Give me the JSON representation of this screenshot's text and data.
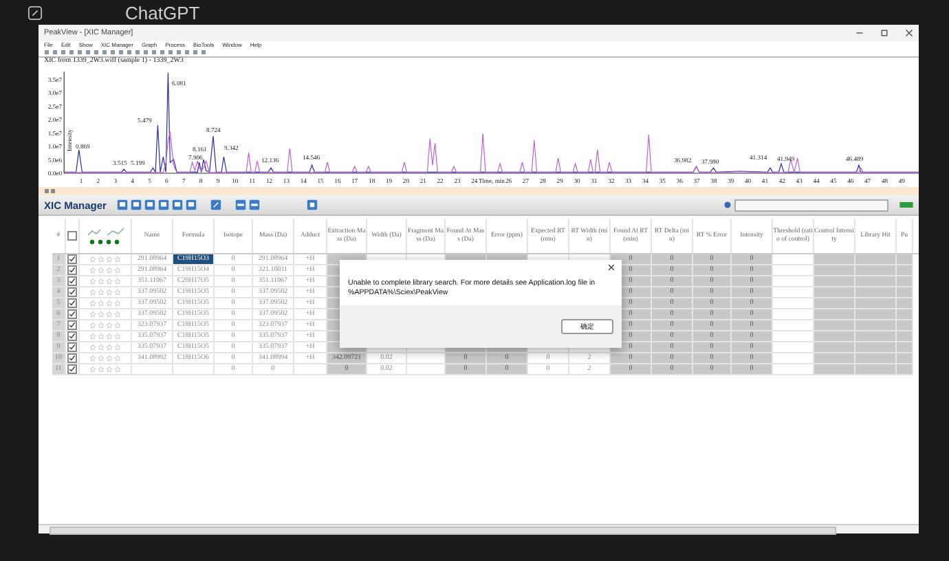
{
  "background_app": {
    "title": "ChatGPT"
  },
  "window": {
    "title": "PeakView - [XIC Manager]"
  },
  "menu": [
    "File",
    "Edit",
    "Show",
    "XIC Manager",
    "Graph",
    "Process",
    "BioTools",
    "Window",
    "Help"
  ],
  "chart": {
    "chart_data": {
      "type": "line",
      "title": "XIC from 1339_2W3.wiff (sample 1) - 1339_2W3",
      "xlabel": "Time, min",
      "ylabel": "Intensity",
      "xlim": [
        0,
        50
      ],
      "ylim": [
        0,
        38000000.0
      ],
      "xticks": [
        1,
        2,
        3,
        4,
        5,
        6,
        7,
        8,
        9,
        10,
        11,
        12,
        13,
        14,
        15,
        16,
        17,
        18,
        19,
        20,
        21,
        22,
        23,
        24,
        26,
        27,
        28,
        29,
        30,
        31,
        32,
        33,
        34,
        35,
        36,
        37,
        38,
        39,
        40,
        41,
        42,
        43,
        44,
        45,
        46,
        47,
        48,
        49
      ],
      "yticks": [
        {
          "value": 35000000.0,
          "label": "3.5e7"
        },
        {
          "value": 30000000.0,
          "label": "3.0e7"
        },
        {
          "value": 25000000.0,
          "label": "2.5e7"
        },
        {
          "value": 20000000.0,
          "label": "2.0e7"
        },
        {
          "value": 15000000.0,
          "label": "1.5e7"
        },
        {
          "value": 10000000.0,
          "label": "1.0e7"
        },
        {
          "value": 5000000.0,
          "label": "5.0e6"
        },
        {
          "value": 0,
          "label": "0.0e0"
        }
      ],
      "x": [
        0,
        0.7,
        0.87,
        1.05,
        3.35,
        3.5,
        3.65,
        5.05,
        5.2,
        5.34,
        5.48,
        5.62,
        5.8,
        5.95,
        6.08,
        6.2,
        6.4,
        6.6,
        7.35,
        7.5,
        7.65,
        7.8,
        7.9,
        8.03,
        8.16,
        8.3,
        8.5,
        8.72,
        8.9,
        9.2,
        9.34,
        9.5,
        10.65,
        10.8,
        10.95,
        11.15,
        11.3,
        11.45,
        11.95,
        12.1,
        12.25,
        13.05,
        13.2,
        13.35,
        14.35,
        14.5,
        14.65,
        15.25,
        15.4,
        15.55,
        16.85,
        17,
        17.15,
        17.65,
        17.8,
        17.95,
        19.75,
        19.9,
        20.05,
        21.25,
        21.4,
        21.55,
        21.7,
        21.85,
        22.65,
        22.8,
        22.95,
        24.35,
        24.5,
        24.65,
        25.35,
        25.5,
        25.65,
        26.65,
        26.8,
        26.95,
        27.35,
        27.5,
        27.65,
        28.75,
        28.9,
        29.05,
        29.75,
        29.9,
        30.05,
        30.65,
        30.8,
        30.95,
        31.05,
        31.2,
        31.35,
        31.75,
        31.9,
        32.05,
        34.05,
        34.2,
        34.35,
        36.8,
        36.98,
        37.15,
        37.8,
        37.98,
        38.15,
        39.5,
        41.15,
        41.3,
        41.45,
        41.8,
        41.95,
        42.1,
        42.35,
        42.5,
        42.7,
        42.9,
        43.05,
        46.35,
        46.49,
        46.6,
        46.75,
        50
      ],
      "series": [
        {
          "color": "#2a2ab0",
          "values": [
            400000.0,
            400000.0,
            8800000.0,
            400000.0,
            400000.0,
            1500000.0,
            400000.0,
            400000.0,
            2000000.0,
            400000.0,
            18000000.0,
            400000.0,
            6200000.0,
            400000.0,
            37600000.0,
            4000000.0,
            5200000.0,
            400000.0,
            400000.0,
            400000.0,
            400000.0,
            400000.0,
            4100000.0,
            400000.0,
            5200000.0,
            1000000.0,
            400000.0,
            13900000.0,
            400000.0,
            400000.0,
            6200000.0,
            400000.0,
            400000.0,
            400000.0,
            400000.0,
            400000.0,
            400000.0,
            400000.0,
            400000.0,
            2000000.0,
            400000.0,
            400000.0,
            400000.0,
            400000.0,
            400000.0,
            3100000.0,
            400000.0,
            400000.0,
            400000.0,
            400000.0,
            400000.0,
            400000.0,
            400000.0,
            400000.0,
            400000.0,
            400000.0,
            400000.0,
            400000.0,
            400000.0,
            400000.0,
            400000.0,
            400000.0,
            400000.0,
            400000.0,
            400000.0,
            400000.0,
            400000.0,
            400000.0,
            400000.0,
            400000.0,
            400000.0,
            400000.0,
            400000.0,
            400000.0,
            400000.0,
            400000.0,
            400000.0,
            400000.0,
            400000.0,
            400000.0,
            400000.0,
            400000.0,
            400000.0,
            400000.0,
            400000.0,
            400000.0,
            400000.0,
            400000.0,
            400000.0,
            400000.0,
            400000.0,
            400000.0,
            400000.0,
            400000.0,
            400000.0,
            400000.0,
            400000.0,
            400000.0,
            2600000.0,
            400000.0,
            400000.0,
            2000000.0,
            400000.0,
            700000.0,
            400000.0,
            2000000.0,
            400000.0,
            400000.0,
            3600000.0,
            400000.0,
            400000.0,
            400000.0,
            400000.0,
            400000.0,
            400000.0,
            400000.0,
            3100000.0,
            500000.0,
            400000.0,
            400000.0
          ]
        },
        {
          "color": "#c060d0",
          "values": [
            300000.0,
            300000.0,
            300000.0,
            300000.0,
            300000.0,
            300000.0,
            300000.0,
            300000.0,
            300000.0,
            300000.0,
            300000.0,
            300000.0,
            300000.0,
            4000000.0,
            12000000.0,
            15500000.0,
            3000000.0,
            300000.0,
            300000.0,
            4100000.0,
            1000000.0,
            4600000.0,
            2000000.0,
            1000000.0,
            2000000.0,
            4600000.0,
            300000.0,
            300000.0,
            300000.0,
            300000.0,
            300000.0,
            300000.0,
            300000.0,
            7700000.0,
            300000.0,
            300000.0,
            4600000.0,
            300000.0,
            300000.0,
            300000.0,
            300000.0,
            300000.0,
            9300000.0,
            300000.0,
            300000.0,
            300000.0,
            300000.0,
            300000.0,
            4100000.0,
            300000.0,
            300000.0,
            2600000.0,
            300000.0,
            300000.0,
            2600000.0,
            300000.0,
            300000.0,
            4100000.0,
            300000.0,
            300000.0,
            12900000.0,
            3000000.0,
            11300000.0,
            300000.0,
            300000.0,
            2600000.0,
            300000.0,
            300000.0,
            14900000.0,
            300000.0,
            300000.0,
            3600000.0,
            300000.0,
            300000.0,
            4100000.0,
            300000.0,
            300000.0,
            12400000.0,
            300000.0,
            300000.0,
            5700000.0,
            300000.0,
            300000.0,
            3600000.0,
            300000.0,
            300000.0,
            5200000.0,
            300000.0,
            300000.0,
            8800000.0,
            300000.0,
            300000.0,
            4100000.0,
            300000.0,
            300000.0,
            14400000.0,
            300000.0,
            300000.0,
            2600000.0,
            300000.0,
            300000.0,
            300000.0,
            300000.0,
            600000.0,
            300000.0,
            300000.0,
            300000.0,
            300000.0,
            300000.0,
            300000.0,
            300000.0,
            5200000.0,
            300000.0,
            5700000.0,
            300000.0,
            300000.0,
            300000.0,
            2000000.0,
            300000.0,
            300000.0
          ]
        }
      ],
      "annotations": [
        "0.869",
        "3.515",
        "5.199",
        "5.479",
        "6.081",
        "7.906",
        "8.161",
        "8.724",
        "9.342",
        "12.136",
        "14.546",
        "36.982",
        "37.980",
        "41.314",
        "41.949",
        "46.489"
      ]
    }
  },
  "xic_manager": {
    "title": "XIC Manager"
  },
  "table": {
    "header_checked": false,
    "columns": [
      {
        "label": "#",
        "kind": "index"
      },
      {
        "kind": "check"
      },
      {
        "kind": "rating"
      },
      {
        "label": "Name",
        "kind": "input"
      },
      {
        "label": "Formula",
        "kind": "input"
      },
      {
        "label": "Isotope",
        "kind": "input"
      },
      {
        "label": "Mass (Da)",
        "kind": "input"
      },
      {
        "label": "Adduct",
        "kind": "input"
      },
      {
        "label": "Extraction Mass (Da)",
        "kind": "result"
      },
      {
        "label": "Width (Da)",
        "kind": "input"
      },
      {
        "label": "Fragment Mass (Da)",
        "kind": "input"
      },
      {
        "label": "Found At Mass (Da)",
        "kind": "result"
      },
      {
        "label": "Error (ppm)",
        "kind": "result"
      },
      {
        "label": "Expected RT (min)",
        "kind": "input"
      },
      {
        "label": "RT Width (min)",
        "kind": "input"
      },
      {
        "label": "Found At RT (min)",
        "kind": "result"
      },
      {
        "label": "RT Delta (min)",
        "kind": "result"
      },
      {
        "label": "RT % Error",
        "kind": "result"
      },
      {
        "label": "Intensity",
        "kind": "result"
      },
      {
        "label": "Threshold (ratio of control)",
        "kind": "input"
      },
      {
        "label": "Control Intensity",
        "kind": "result"
      },
      {
        "label": "Library Hit",
        "kind": "result"
      },
      {
        "label": "Pu",
        "kind": "result"
      }
    ],
    "rows": [
      {
        "checked": true,
        "stars": 0,
        "formula_selected": true,
        "cells": [
          "1",
          null,
          null,
          "291.08964",
          "C19H15O3",
          "0",
          "291.08964",
          "+H",
          null,
          null,
          null,
          null,
          null,
          null,
          null,
          "0",
          "0",
          "0",
          "0",
          null,
          null,
          null,
          null
        ]
      },
      {
        "checked": true,
        "stars": 0,
        "formula_selected": false,
        "cells": [
          "2",
          null,
          null,
          "291.08964",
          "C19H15O4",
          "0",
          "321.10011",
          "+H",
          null,
          null,
          null,
          null,
          null,
          null,
          null,
          "0",
          "0",
          "0",
          "0",
          null,
          null,
          null,
          null
        ]
      },
      {
        "checked": true,
        "stars": 0,
        "formula_selected": false,
        "cells": [
          "3",
          null,
          null,
          "351.11067",
          "C20H17O5",
          "0",
          "351.11067",
          "+H",
          null,
          null,
          null,
          null,
          null,
          null,
          null,
          "0",
          "0",
          "0",
          "0",
          null,
          null,
          null,
          null
        ]
      },
      {
        "checked": true,
        "stars": 0,
        "formula_selected": false,
        "cells": [
          "4",
          null,
          null,
          "337.09502",
          "C19H15O5",
          "0",
          "337.09502",
          "+H",
          null,
          null,
          null,
          null,
          null,
          null,
          null,
          "0",
          "0",
          "0",
          "0",
          null,
          null,
          null,
          null
        ]
      },
      {
        "checked": true,
        "stars": 0,
        "formula_selected": false,
        "cells": [
          "5",
          null,
          null,
          "337.09502",
          "C19H15O5",
          "0",
          "337.09502",
          "+H",
          null,
          null,
          null,
          null,
          null,
          null,
          null,
          "0",
          "0",
          "0",
          "0",
          null,
          null,
          null,
          null
        ]
      },
      {
        "checked": true,
        "stars": 0,
        "formula_selected": false,
        "cells": [
          "6",
          null,
          null,
          "337.09502",
          "C19H15O5",
          "0",
          "337.09502",
          "+H",
          null,
          null,
          null,
          null,
          null,
          null,
          null,
          "0",
          "0",
          "0",
          "0",
          null,
          null,
          null,
          null
        ]
      },
      {
        "checked": true,
        "stars": 0,
        "formula_selected": false,
        "cells": [
          "7",
          null,
          null,
          "323.07937",
          "C18H15O5",
          "0",
          "323.07937",
          "+H",
          null,
          null,
          null,
          null,
          null,
          null,
          null,
          "0",
          "0",
          "0",
          "0",
          null,
          null,
          null,
          null
        ]
      },
      {
        "checked": true,
        "stars": 0,
        "formula_selected": false,
        "cells": [
          "8",
          null,
          null,
          "335.07937",
          "C18H15O5",
          "0",
          "335.07937",
          "+H",
          null,
          null,
          null,
          null,
          null,
          null,
          null,
          "0",
          "0",
          "0",
          "0",
          null,
          null,
          null,
          null
        ]
      },
      {
        "checked": true,
        "stars": 0,
        "formula_selected": false,
        "cells": [
          "9",
          null,
          null,
          "335.07937",
          "C18H15O5",
          "0",
          "335.07937",
          "+H",
          null,
          null,
          null,
          null,
          null,
          null,
          null,
          "0",
          "0",
          "0",
          "0",
          null,
          null,
          null,
          null
        ]
      },
      {
        "checked": true,
        "stars": 0,
        "formula_selected": false,
        "cells": [
          "10",
          null,
          null,
          "341.08992",
          "C18H15O6",
          "0",
          "341.08994",
          "+H",
          "342.09721",
          "0.02",
          null,
          "0",
          "0",
          "0",
          "2",
          "0",
          "0",
          "0",
          "0",
          null,
          null,
          null,
          null
        ]
      },
      {
        "checked": true,
        "stars": 0,
        "formula_selected": false,
        "cells": [
          "11",
          null,
          null,
          null,
          null,
          "0",
          "0",
          null,
          "0",
          "0.02",
          null,
          "0",
          "0",
          "0",
          "2",
          "0",
          "0",
          "0",
          "0",
          null,
          null,
          null,
          null
        ]
      }
    ]
  },
  "dialog": {
    "message": "Unable to complete library search. For more details see Application.log file in %APPDATA%\\Sciex\\PeakView",
    "button": "确定"
  }
}
